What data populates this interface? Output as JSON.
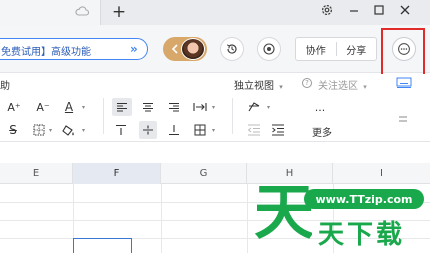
{
  "tabbar": {
    "add_tab": "+"
  },
  "header": {
    "promo_text": "免费试用】高级功能",
    "promo_arrow": "»",
    "collab_label": "协作",
    "share_label": "分享"
  },
  "viewrow": {
    "left_text": "助",
    "view_mode": "独立视图",
    "view_mode_arrow": "▾",
    "focus_label": "关注选区",
    "focus_arrow": "▾"
  },
  "toolbar": {
    "font_grow": "A⁺",
    "font_shrink": "A⁻",
    "font_color": "A",
    "strike": "S",
    "ellipsis": "...",
    "more_label": "更多"
  },
  "columns": [
    "E",
    "F",
    "G",
    "H",
    "I"
  ],
  "watermark": {
    "url": "www.TTzip.com",
    "big_char": "天",
    "chars": "天下载"
  },
  "colors": {
    "accent_blue": "#4285f4",
    "highlight_red": "#e12b2b",
    "watermark_green": "#1aa84c"
  }
}
